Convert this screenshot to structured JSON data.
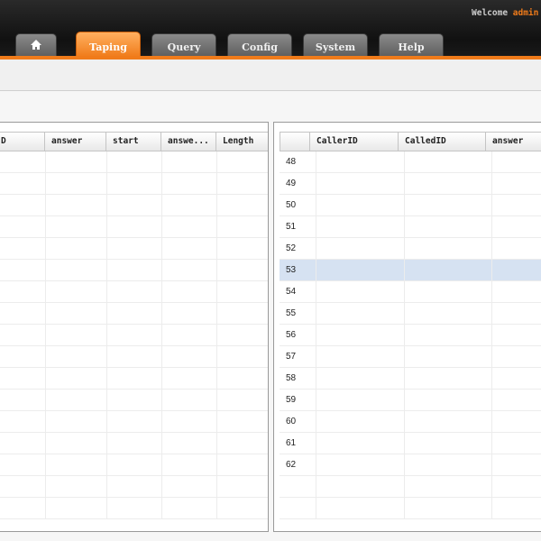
{
  "header": {
    "welcome_prefix": "Welcome ",
    "user": "admin"
  },
  "tabs": [
    {
      "label": "",
      "icon": "home-icon"
    },
    {
      "label": "Taping",
      "active": true
    },
    {
      "label": "Query"
    },
    {
      "label": "Config"
    },
    {
      "label": "System"
    },
    {
      "label": "Help"
    }
  ],
  "left_grid": {
    "columns": [
      "D",
      "answer",
      "start",
      "answe...",
      "Length"
    ]
  },
  "right_grid": {
    "columns": [
      "CallerID",
      "CalledID",
      "answer"
    ],
    "row_numbers": [
      "48",
      "49",
      "50",
      "51",
      "52",
      "53",
      "54",
      "55",
      "56",
      "57",
      "58",
      "59",
      "60",
      "61",
      "62"
    ],
    "selected_row": "53"
  },
  "colors": {
    "accent": "#f07b1a",
    "selection": "#d6e2f2"
  }
}
